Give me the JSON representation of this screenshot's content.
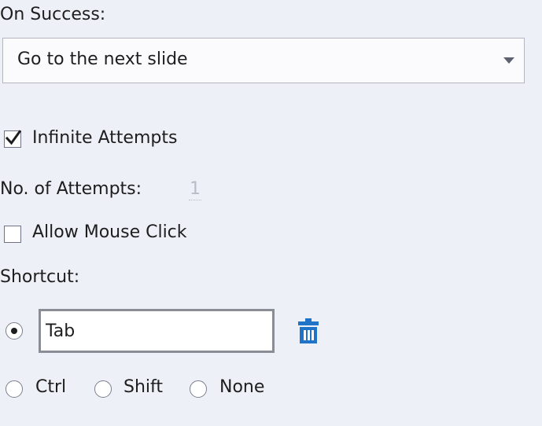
{
  "on_success": {
    "label": "On Success:",
    "selected": "Go to the next slide"
  },
  "infinite_attempts": {
    "label": "Infinite Attempts",
    "checked": true
  },
  "attempts": {
    "label": "No. of Attempts:",
    "value": "1"
  },
  "allow_mouse_click": {
    "label": "Allow Mouse Click",
    "checked": false
  },
  "shortcut": {
    "label": "Shortcut:",
    "value": "Tab",
    "selected_mode": "key",
    "options": {
      "ctrl": "Ctrl",
      "shift": "Shift",
      "none": "None"
    }
  },
  "icons": {
    "delete": "trash-icon",
    "dropdown": "chevron-down-icon",
    "checkmark": "checkmark-icon"
  },
  "colors": {
    "background": "#eef0f7",
    "accent_blue": "#1f74c7",
    "disabled_text": "#b9bcc6"
  }
}
